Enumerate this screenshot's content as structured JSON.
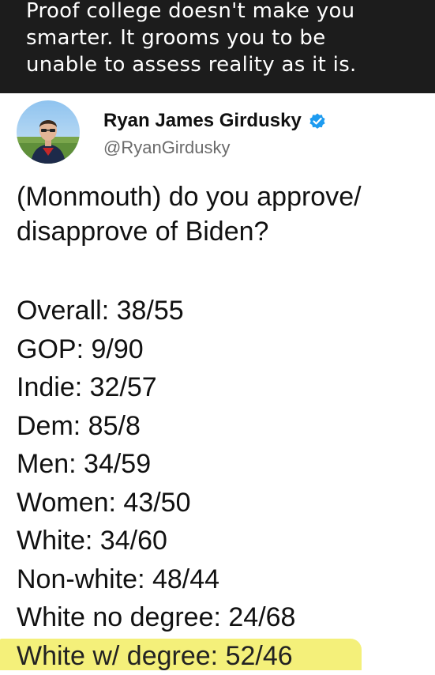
{
  "caption": {
    "line1": "Proof college doesn't make you",
    "line2": "smarter. It grooms you to be",
    "line3": "unable to assess reality as it is."
  },
  "tweet": {
    "author_name": "Ryan James Girdusky",
    "handle": "@RyanGirdusky",
    "verified_icon": "verified-badge-icon",
    "accent_color": "#1d9bf0",
    "question_line1": "(Monmouth) do you approve/",
    "question_line2": "disapprove of Biden?",
    "stats": [
      "Overall: 38/55",
      "GOP: 9/90",
      "Indie: 32/57",
      "Dem: 85/8",
      "Men: 34/59",
      "Women: 43/50",
      "White: 34/60",
      "Non-white: 48/44",
      "White no degree: 24/68",
      "White w/ degree: 52/46"
    ],
    "highlight_color": "#f4f07a"
  }
}
